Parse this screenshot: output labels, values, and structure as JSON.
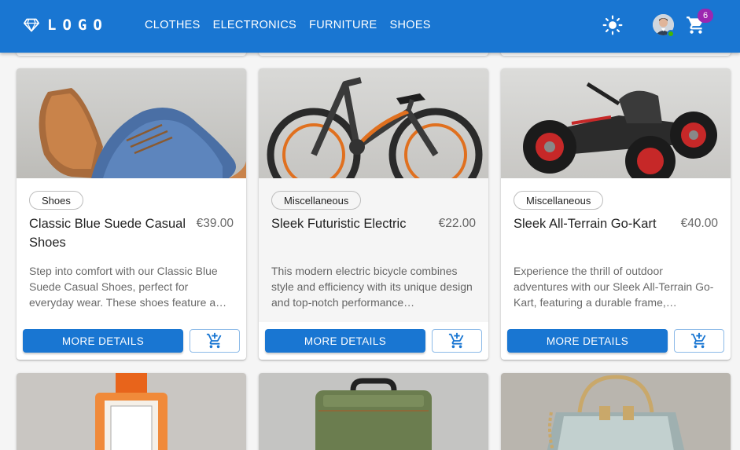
{
  "header": {
    "logo_text": "LOGO",
    "nav": [
      "CLOTHES",
      "ELECTRONICS",
      "FURNITURE",
      "SHOES"
    ],
    "cart_count": "6",
    "icons": [
      "diamond-icon",
      "sun-icon",
      "avatar",
      "shopping-cart-icon"
    ],
    "colors": {
      "appbar": "#1976d2",
      "badge": "#9c27b0",
      "online": "#44b700"
    }
  },
  "products": [
    {
      "category": "Shoes",
      "title": "Classic Blue Suede Casual Shoes",
      "price": "€39.00",
      "description": "Step into comfort with our Classic Blue Suede Casual Shoes, perfect for everyday wear. These shoes feature a…",
      "details_label": "MORE DETAILS"
    },
    {
      "category": "Miscellaneous",
      "title": "Sleek Futuristic Electric",
      "price": "€22.00",
      "description": "This modern electric bicycle combines style and efficiency with its unique design and top-notch performance…",
      "details_label": "MORE DETAILS"
    },
    {
      "category": "Miscellaneous",
      "title": "Sleek All-Terrain Go-Kart",
      "price": "€40.00",
      "description": "Experience the thrill of outdoor adventures with our Sleek All-Terrain Go-Kart, featuring a durable frame,…",
      "details_label": "MORE DETAILS"
    }
  ],
  "next_row": [
    "perfume-image",
    "green-suitcase-image",
    "glossy-handbag-image"
  ]
}
